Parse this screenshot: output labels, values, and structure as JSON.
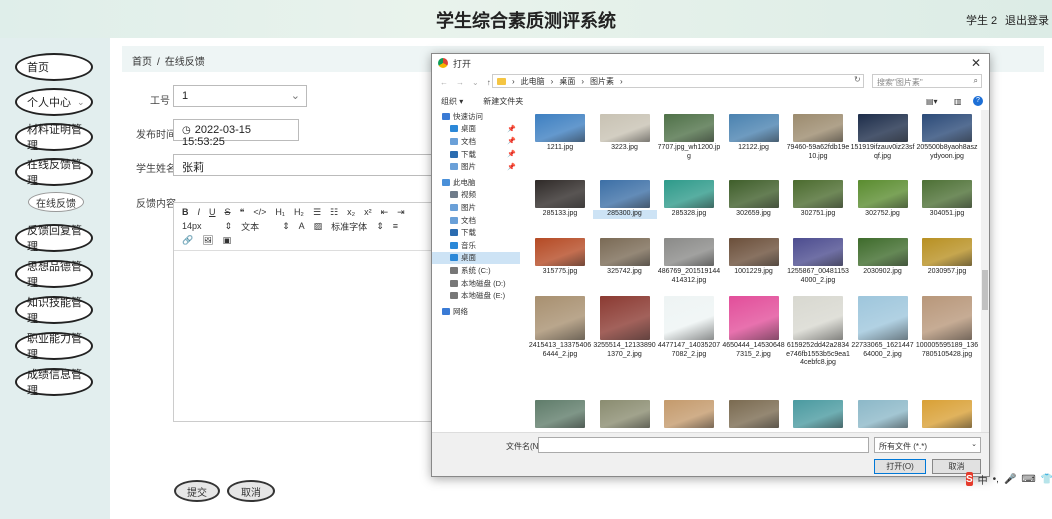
{
  "header": {
    "title": "学生综合素质测评系统",
    "user": "学生 2",
    "logout": "退出登录"
  },
  "sidebar": {
    "items": [
      {
        "label": "首页"
      },
      {
        "label": "个人中心"
      },
      {
        "label": "材料证明管理"
      },
      {
        "label": "在线反馈管理"
      },
      {
        "label": "在线反馈",
        "sub": true
      },
      {
        "label": "反馈回复管理"
      },
      {
        "label": "思想品德管理"
      },
      {
        "label": "知识技能管理"
      },
      {
        "label": "职业能力管理"
      },
      {
        "label": "成绩信息管理"
      }
    ]
  },
  "breadcrumb": {
    "home": "首页",
    "sep": "/",
    "current": "在线反馈"
  },
  "form": {
    "job_no_label": "工号",
    "job_no_value": "1",
    "time_label": "发布时间",
    "time_value": "2022-03-15 15:53:25",
    "name_label": "学生姓名",
    "name_value": "张莉",
    "content_label": "反馈内容",
    "toolbar_row1": [
      "B",
      "I",
      "U",
      "S",
      "❝",
      "</>",
      "H₁",
      "H₂",
      "☰",
      "☷",
      "x₂",
      "x²",
      "⇤",
      "⇥"
    ],
    "toolbar_row2": [
      "14px",
      "⇕",
      "文本",
      "⇕",
      "A",
      "▨",
      "标准字体",
      "⇕",
      "≡"
    ],
    "toolbar_row3": [
      "🔗",
      "🖼",
      "▣"
    ],
    "submit": "提交",
    "cancel": "取消"
  },
  "dialog": {
    "title": "打开",
    "close": "✕",
    "path": [
      "此电脑",
      "桌面",
      "图片素"
    ],
    "search_placeholder": "搜索\"图片素\"",
    "organize": "组织 ▾",
    "new_folder": "新建文件夹",
    "tree": [
      {
        "label": "快速访问",
        "level": 0,
        "color": "#3a7bd5"
      },
      {
        "label": "桌面",
        "level": 1,
        "color": "#2b88d8",
        "pin": true
      },
      {
        "label": "文档",
        "level": 1,
        "color": "#6aa0d8",
        "pin": true
      },
      {
        "label": "下载",
        "level": 1,
        "color": "#2b6cb0",
        "pin": true
      },
      {
        "label": "图片",
        "level": 1,
        "color": "#6aa0d8",
        "pin": true
      },
      {
        "label": "此电脑",
        "level": 0,
        "color": "#4a90d9"
      },
      {
        "label": "视频",
        "level": 1,
        "color": "#6f7c8a"
      },
      {
        "label": "图片",
        "level": 1,
        "color": "#6aa0d8"
      },
      {
        "label": "文档",
        "level": 1,
        "color": "#6aa0d8"
      },
      {
        "label": "下载",
        "level": 1,
        "color": "#2b6cb0"
      },
      {
        "label": "音乐",
        "level": 1,
        "color": "#2b88d8"
      },
      {
        "label": "桌面",
        "level": 1,
        "color": "#2b88d8",
        "selected": true
      },
      {
        "label": "系统 (C:)",
        "level": 1,
        "color": "#777"
      },
      {
        "label": "本地磁盘 (D:)",
        "level": 1,
        "color": "#777"
      },
      {
        "label": "本地磁盘 (E:)",
        "level": 1,
        "color": "#777"
      },
      {
        "label": "网络",
        "level": 0,
        "color": "#3a7bd5"
      }
    ],
    "files": [
      {
        "name": "1211.jpg",
        "color": "#3d7fc1"
      },
      {
        "name": "3223.jpg",
        "color": "#c8c2b3"
      },
      {
        "name": "7707.jpg_wh1200.jpg",
        "color": "#4f7148"
      },
      {
        "name": "12122.jpg",
        "color": "#4a82b0"
      },
      {
        "name": "79460-59a62fdb19e10.jpg",
        "color": "#9c8b6e"
      },
      {
        "name": "151919ifzauv0iz23sfqf.jpg",
        "color": "#1d2d4a"
      },
      {
        "name": "205500b8yaoh8aszydyoon.jpg",
        "color": "#2b4a78"
      },
      {
        "name": "285133.jpg",
        "color": "#2f2a28"
      },
      {
        "name": "285300.jpg",
        "color": "#3c6fa6",
        "selected": true
      },
      {
        "name": "285328.jpg",
        "color": "#2e9a8a"
      },
      {
        "name": "302659.jpg",
        "color": "#3f5e2a"
      },
      {
        "name": "302751.jpg",
        "color": "#4b6b2e"
      },
      {
        "name": "302752.jpg",
        "color": "#5a8c2f"
      },
      {
        "name": "304051.jpg",
        "color": "#4d7035"
      },
      {
        "name": "315775.jpg",
        "color": "#b54a24"
      },
      {
        "name": "325742.jpg",
        "color": "#7a6a55"
      },
      {
        "name": "486769_201519144414312.jpg",
        "color": "#8a8a88"
      },
      {
        "name": "1001229.jpg",
        "color": "#6b4f3a"
      },
      {
        "name": "1255867_004811534000_2.jpg",
        "color": "#4c4c8f"
      },
      {
        "name": "2030902.jpg",
        "color": "#3e6b2b"
      },
      {
        "name": "2030957.jpg",
        "color": "#b89022"
      },
      {
        "name": "2415413_133754066444_2.jpg",
        "color": "#a89070"
      },
      {
        "name": "3255514_121338901370_2.jpg",
        "color": "#8b3a32"
      },
      {
        "name": "4477147_140352077082_2.jpg",
        "color": "#eef4f4"
      },
      {
        "name": "4650444_145306487315_2.jpg",
        "color": "#e24e9a"
      },
      {
        "name": "6159252dd42a2834e746fb1553b5c9ea14cebfc8.jpg",
        "color": "#d8d8d0"
      },
      {
        "name": "22733065_162144764000_2.jpg",
        "color": "#9ec6dc"
      },
      {
        "name": "100005595189_1367805105428.jpg",
        "color": "#b8977a"
      },
      {
        "name": "",
        "color": "#5f7c6a"
      },
      {
        "name": "",
        "color": "#8a8c70"
      },
      {
        "name": "",
        "color": "#c49a6c"
      },
      {
        "name": "",
        "color": "#7a6a50"
      },
      {
        "name": "",
        "color": "#4a9aa0"
      },
      {
        "name": "",
        "color": "#8cb8c8"
      },
      {
        "name": "",
        "color": "#d9a035"
      }
    ],
    "filename_label": "文件名(N):",
    "filetype": "所有文件 (*.*)",
    "open_button": "打开(O)",
    "cancel_button": "取消"
  },
  "ime": {
    "lang": "中"
  }
}
